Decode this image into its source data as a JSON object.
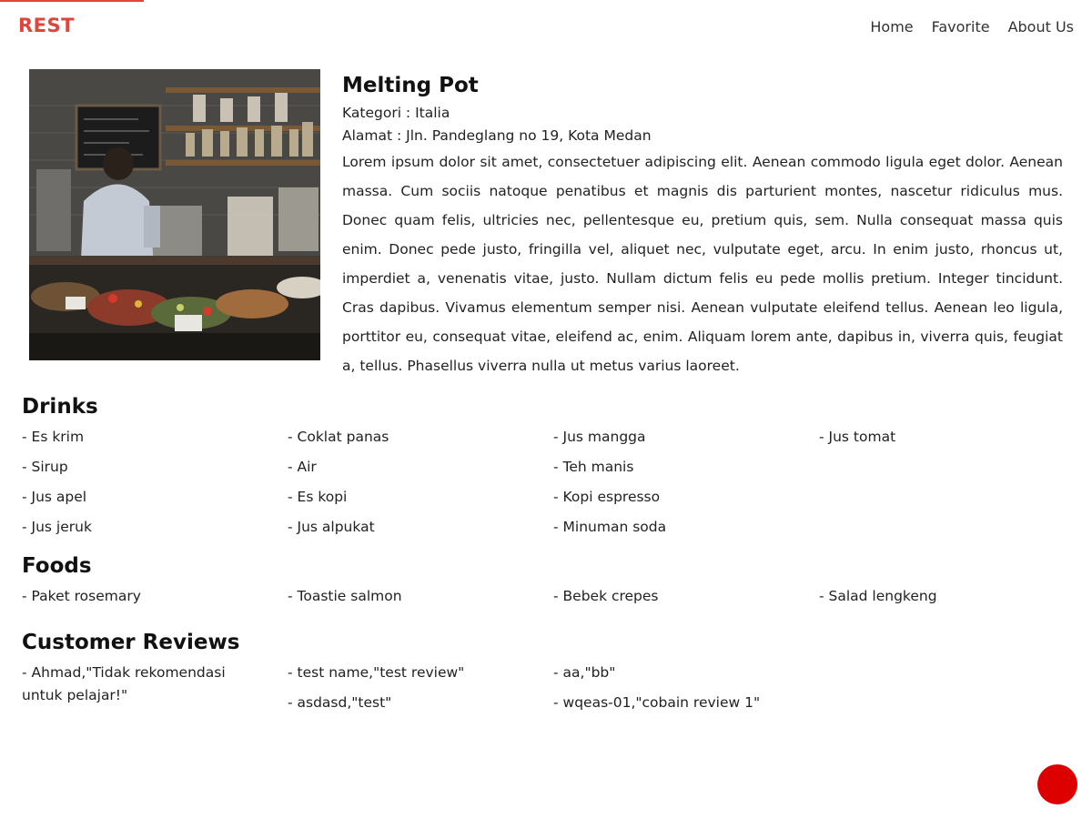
{
  "brand": "REST",
  "nav": [
    {
      "label": "Home"
    },
    {
      "label": "Favorite"
    },
    {
      "label": "About Us"
    }
  ],
  "restaurant": {
    "name": "Melting Pot",
    "category": "Kategori : Italia",
    "address": "Alamat : Jln. Pandeglang no 19, Kota Medan",
    "description": "Lorem ipsum dolor sit amet, consectetuer adipiscing elit. Aenean commodo ligula eget dolor. Aenean massa. Cum sociis natoque penatibus et magnis dis parturient montes, nascetur ridiculus mus. Donec quam felis, ultricies nec, pellentesque eu, pretium quis, sem. Nulla consequat massa quis enim. Donec pede justo, fringilla vel, aliquet nec, vulputate eget, arcu. In enim justo, rhoncus ut, imperdiet a, venenatis vitae, justo. Nullam dictum felis eu pede mollis pretium. Integer tincidunt. Cras dapibus. Vivamus elementum semper nisi. Aenean vulputate eleifend tellus. Aenean leo ligula, porttitor eu, consequat vitae, eleifend ac, enim. Aliquam lorem ante, dapibus in, viverra quis, feugiat a, tellus. Phasellus viverra nulla ut metus varius laoreet."
  },
  "drinks": {
    "title": "Drinks",
    "columns": [
      [
        "- Es krim",
        "- Sirup",
        "- Jus apel",
        "- Jus jeruk"
      ],
      [
        "- Coklat panas",
        "- Air",
        "- Es kopi",
        "- Jus alpukat"
      ],
      [
        "- Jus mangga",
        "- Teh manis",
        "- Kopi espresso",
        "- Minuman soda"
      ],
      [
        "- Jus tomat"
      ]
    ]
  },
  "foods": {
    "title": "Foods",
    "columns": [
      [
        "- Paket rosemary"
      ],
      [
        "- Toastie salmon"
      ],
      [
        "- Bebek crepes"
      ],
      [
        "- Salad lengkeng"
      ]
    ]
  },
  "reviews": {
    "title": "Customer Reviews",
    "columns": [
      [
        "- Ahmad,\"Tidak rekomendasi untuk pelajar!\""
      ],
      [
        "- test name,\"test review\"",
        "- asdasd,\"test\""
      ],
      [
        "- aa,\"bb\"",
        "- wqeas-01,\"cobain review 1\""
      ]
    ]
  },
  "colors": {
    "brand": "#e0443a",
    "fab": "#dd0000"
  },
  "icons": {
    "fab": "circle-button"
  }
}
